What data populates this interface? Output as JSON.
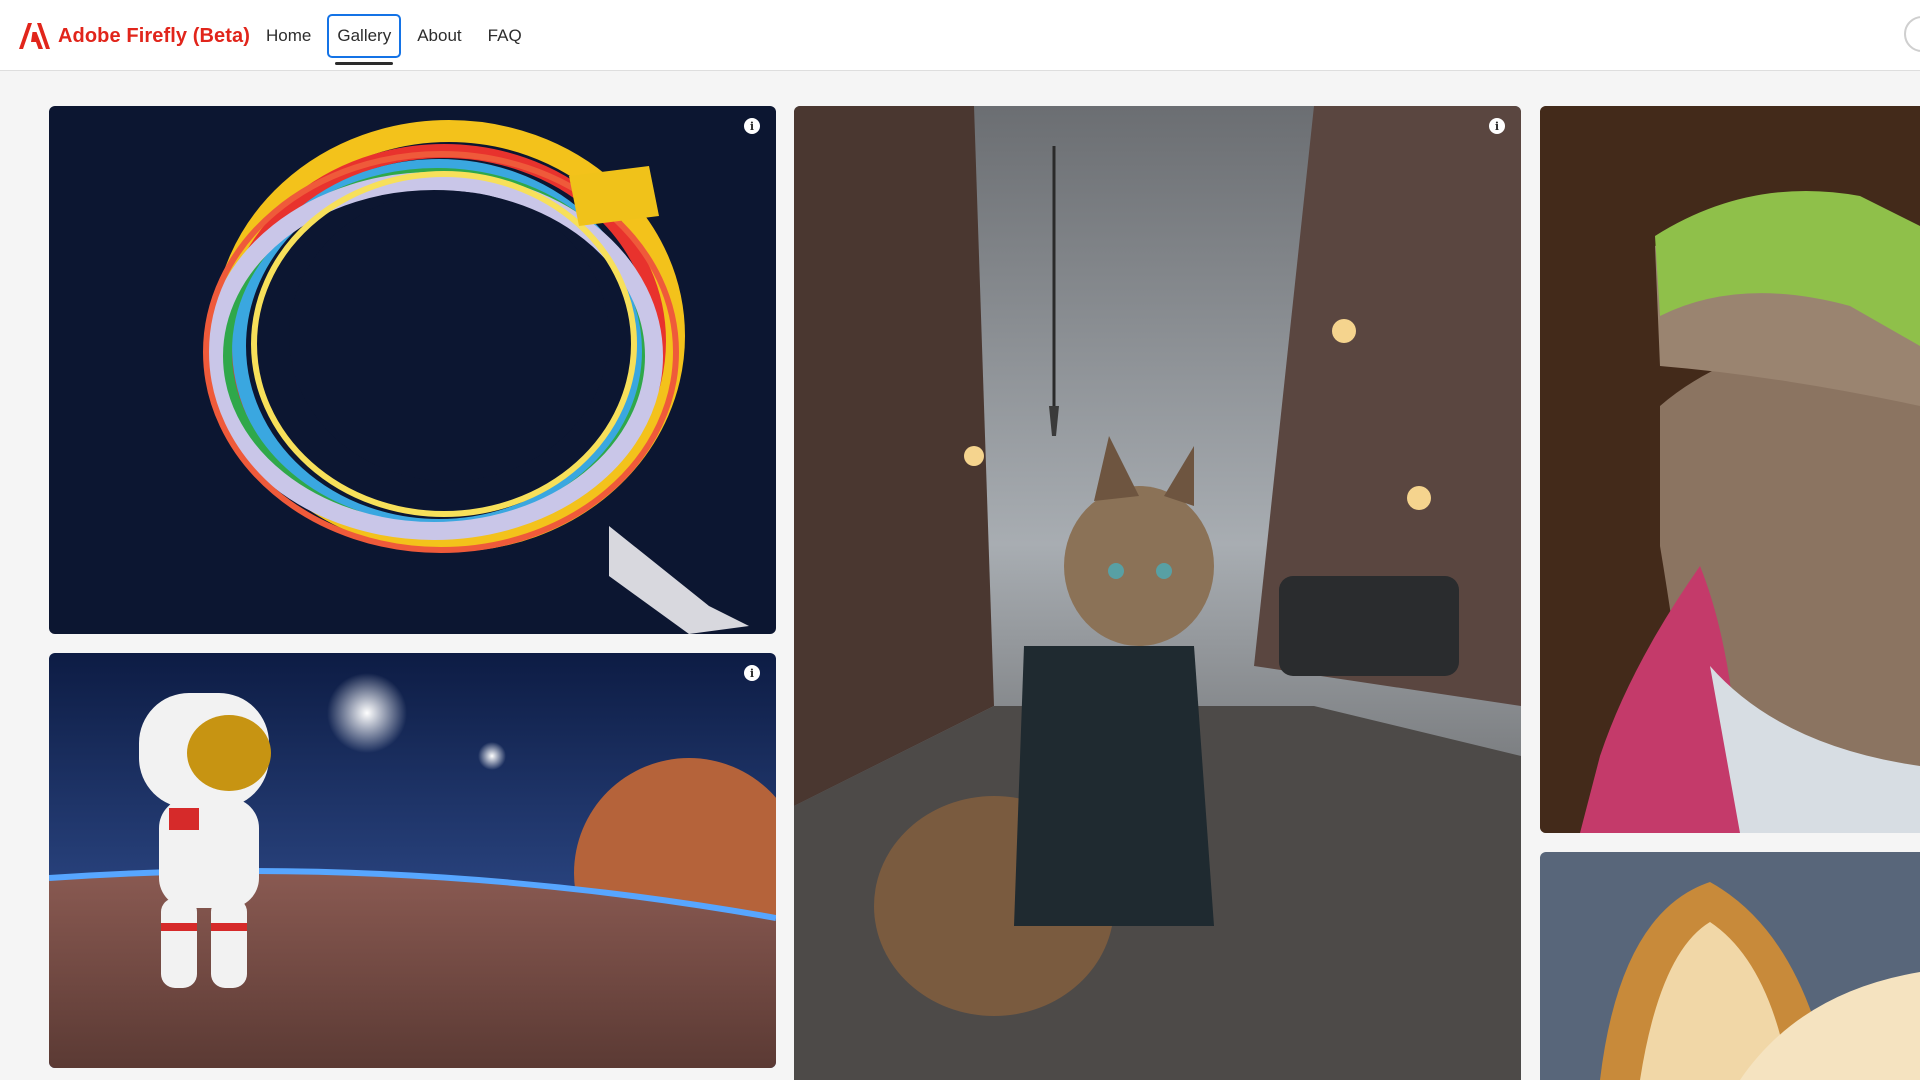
{
  "app": {
    "brand": "Adobe Firefly (Beta)",
    "brand_color": "#e1251b",
    "accent_color": "#1473e6"
  },
  "nav": {
    "items": [
      {
        "label": "Home",
        "active": false
      },
      {
        "label": "Gallery",
        "active": true
      },
      {
        "label": "About",
        "active": false
      },
      {
        "label": "FAQ",
        "active": false
      }
    ]
  },
  "gallery": {
    "tiles": [
      {
        "subject": "letter Q made of colorful cables",
        "has_info": true
      },
      {
        "subject": "astronaut toy on planet surface",
        "has_info": true
      },
      {
        "subject": "cat in leather jacket on rainy street",
        "has_info": true
      },
      {
        "subject": "lizard in pink jacket",
        "has_info": false
      },
      {
        "subject": "fluffy animal ear",
        "has_info": false
      }
    ],
    "info_icon": "info-icon"
  }
}
